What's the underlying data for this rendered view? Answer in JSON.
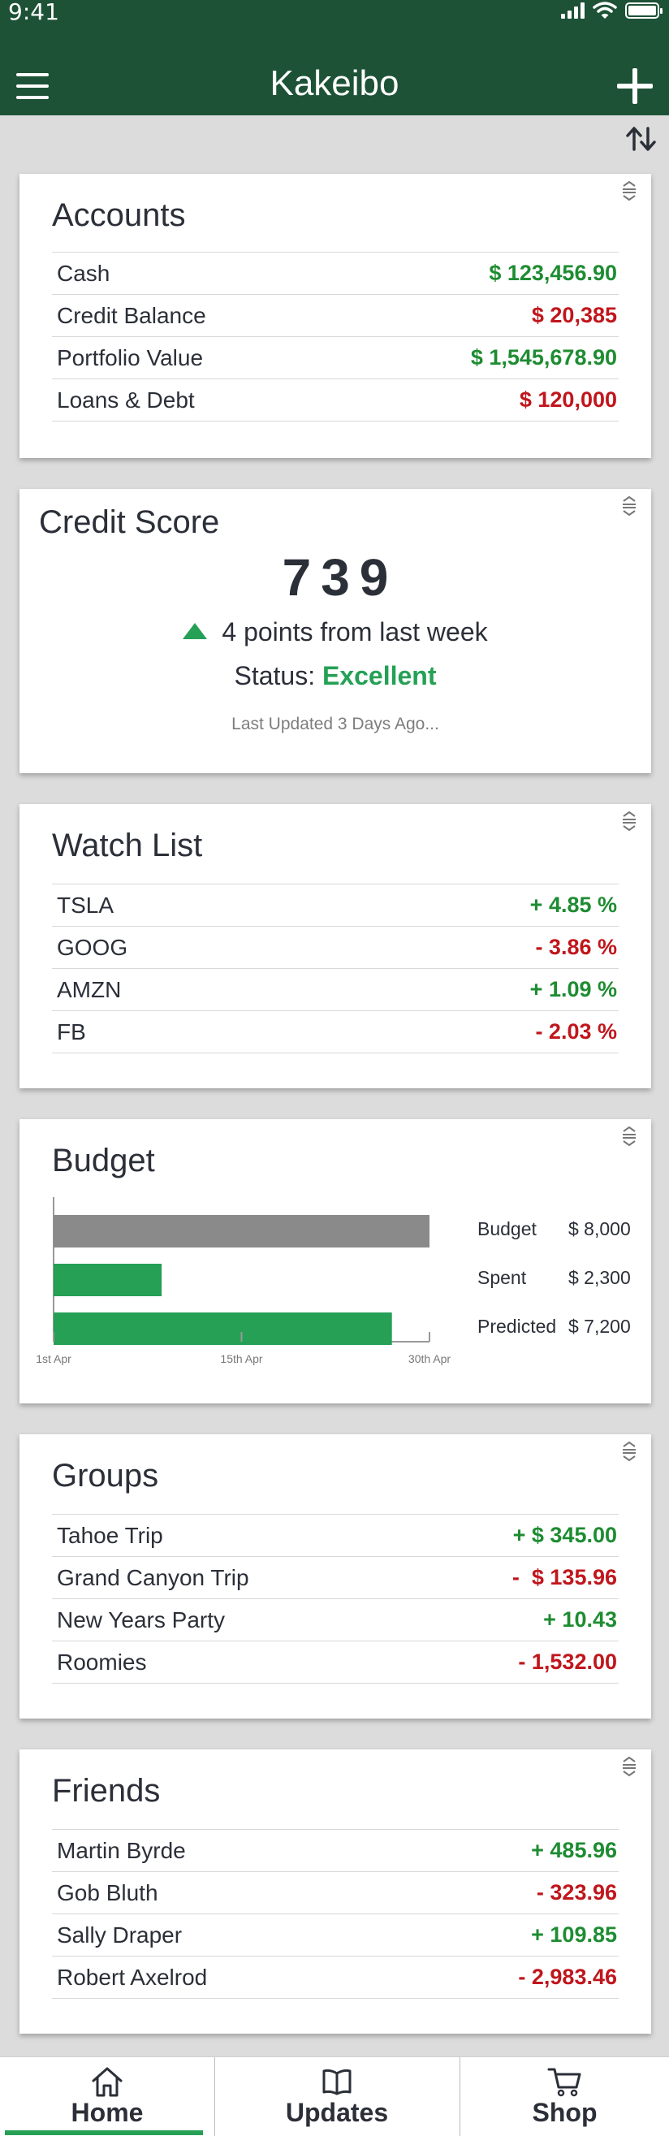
{
  "colors": {
    "header": "#1d5236",
    "positive": "#1e8c32",
    "negative": "#c0161c",
    "bar_budget": "#8a8a8a",
    "bar_green": "#25a055"
  },
  "status_bar": {
    "time": "9:41"
  },
  "header": {
    "title": "Kakeibo",
    "menu_icon": "hamburger-menu-icon",
    "add_icon": "plus-icon",
    "sort_icon": "sort-arrows-icon"
  },
  "accounts": {
    "title": "Accounts",
    "rows": [
      {
        "label": "Cash",
        "value": "$ 123,456.90",
        "trend": "positive"
      },
      {
        "label": "Credit Balance",
        "value": "$ 20,385",
        "trend": "negative"
      },
      {
        "label": "Portfolio Value",
        "value": "$ 1,545,678.90",
        "trend": "positive"
      },
      {
        "label": "Loans & Debt",
        "value": "$ 120,000",
        "trend": "negative"
      }
    ]
  },
  "credit": {
    "title": "Credit Score",
    "score": "739",
    "delta_text": "4 points from last week",
    "status_label": "Status:",
    "status_value": "Excellent",
    "updated": "Last Updated 3 Days Ago..."
  },
  "watchlist": {
    "title": "Watch List",
    "rows": [
      {
        "label": "TSLA",
        "value": "+ 4.85 %",
        "trend": "positive"
      },
      {
        "label": "GOOG",
        "value": "- 3.86 %",
        "trend": "negative"
      },
      {
        "label": "AMZN",
        "value": "+ 1.09 %",
        "trend": "positive"
      },
      {
        "label": "FB",
        "value": "- 2.03 %",
        "trend": "negative"
      }
    ]
  },
  "budget": {
    "title": "Budget",
    "legend": [
      {
        "label": "Budget",
        "value": "$ 8,000"
      },
      {
        "label": "Spent",
        "value": "$ 2,300"
      },
      {
        "label": "Predicted",
        "value": "$ 7,200"
      }
    ]
  },
  "chart_data": {
    "type": "bar",
    "orientation": "horizontal",
    "categories": [
      "Budget",
      "Spent",
      "Predicted"
    ],
    "values": [
      8000,
      2300,
      7200
    ],
    "colors": [
      "#8a8a8a",
      "#25a055",
      "#25a055"
    ],
    "x_ticks": [
      "1st Apr",
      "15th Apr",
      "30th Apr"
    ],
    "xlim": [
      0,
      8000
    ],
    "grid": false
  },
  "groups": {
    "title": "Groups",
    "rows": [
      {
        "label": "Tahoe Trip",
        "value": "+ $ 345.00",
        "trend": "positive"
      },
      {
        "label": "Grand Canyon Trip",
        "value": "-  $ 135.96",
        "trend": "negative"
      },
      {
        "label": "New Years Party",
        "value": "+ 10.43",
        "trend": "positive"
      },
      {
        "label": "Roomies",
        "value": "- 1,532.00",
        "trend": "negative"
      }
    ]
  },
  "friends": {
    "title": "Friends",
    "rows": [
      {
        "label": "Martin Byrde",
        "value": "+ 485.96",
        "trend": "positive"
      },
      {
        "label": "Gob Bluth",
        "value": "- 323.96",
        "trend": "negative"
      },
      {
        "label": "Sally Draper",
        "value": "+ 109.85",
        "trend": "positive"
      },
      {
        "label": "Robert Axelrod",
        "value": "- 2,983.46",
        "trend": "negative"
      }
    ]
  },
  "tabs": [
    {
      "label": "Home",
      "icon": "home-icon",
      "active": true
    },
    {
      "label": "Updates",
      "icon": "book-icon",
      "active": false
    },
    {
      "label": "Shop",
      "icon": "cart-icon",
      "active": false
    }
  ]
}
